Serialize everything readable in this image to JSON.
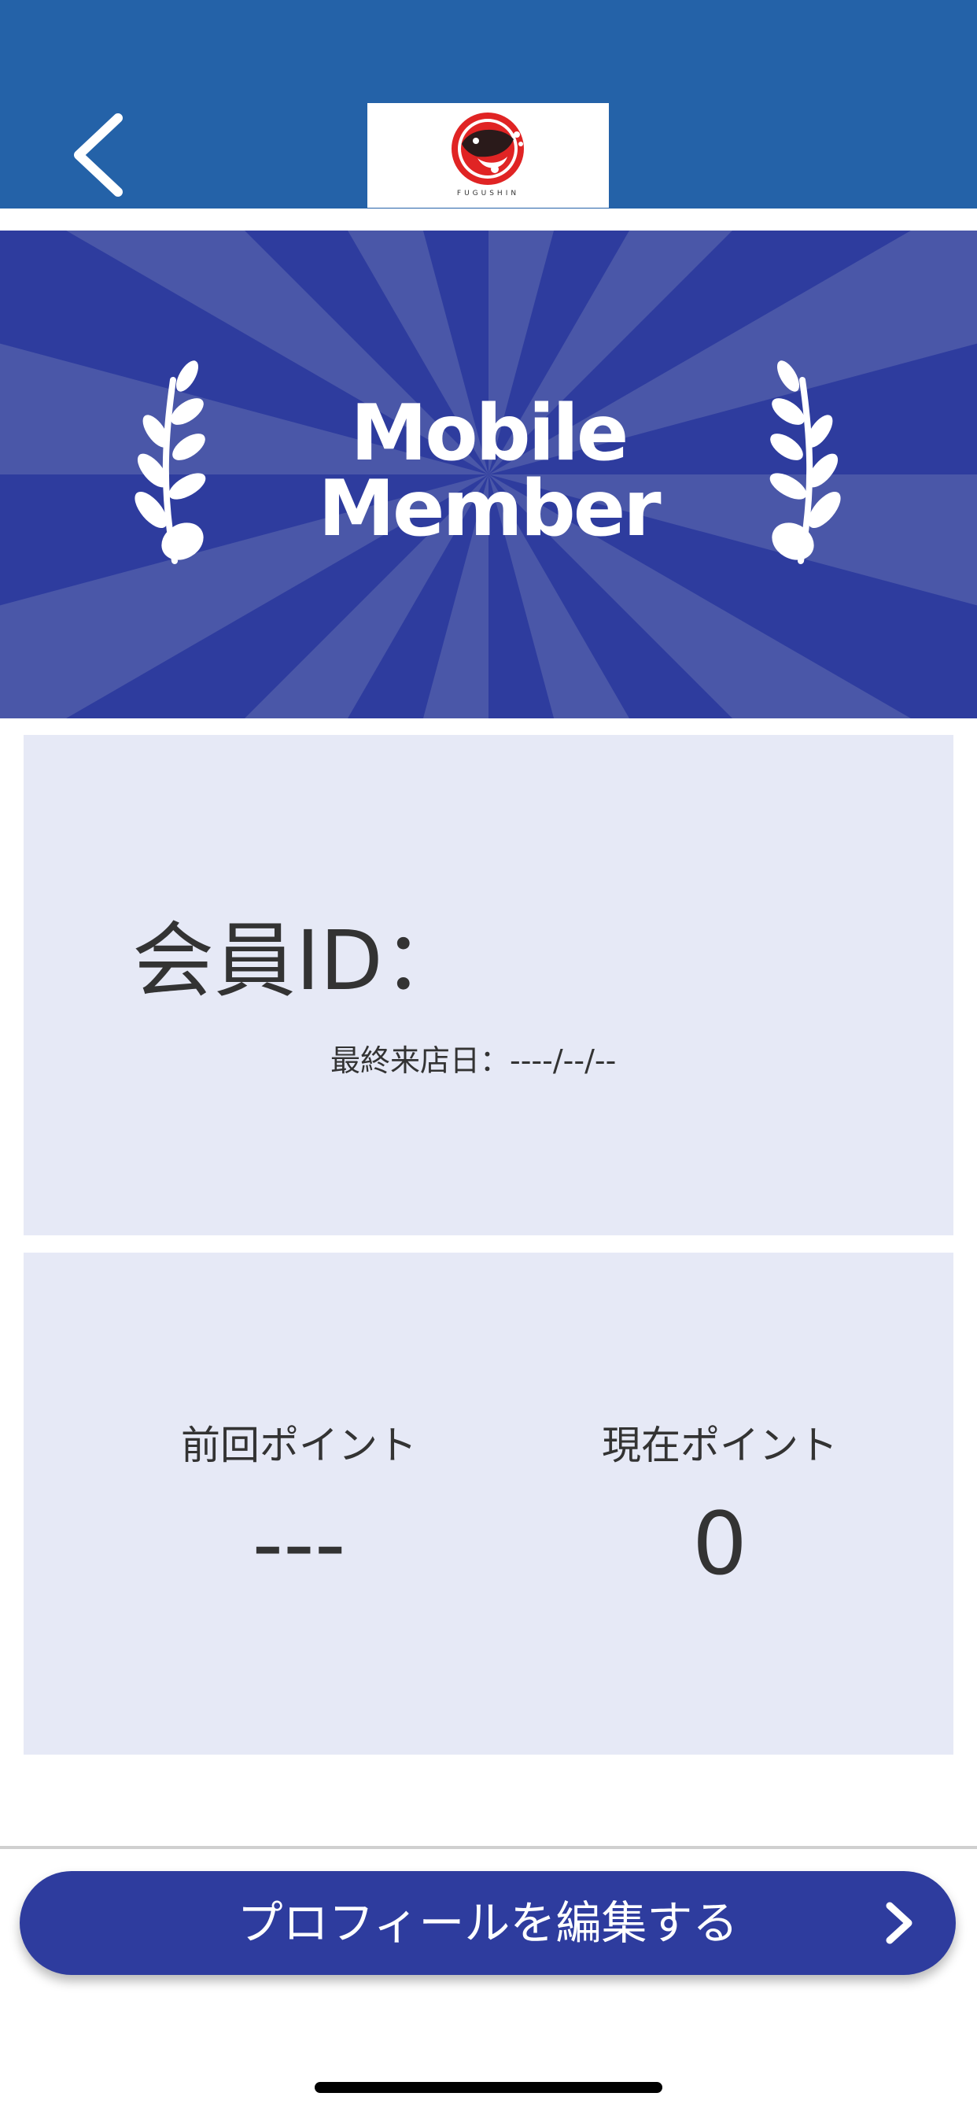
{
  "header": {
    "back_icon": "chevron-left-icon",
    "logo_caption": "FUGUSHIN",
    "background_color": "#2462a8"
  },
  "banner": {
    "title_line1": "Mobile",
    "title_line2": "Member",
    "background_color": "#2e3c9e"
  },
  "member_card": {
    "member_id_label": "会員ID：",
    "last_visit": "最終来店日：----/--/--"
  },
  "points_card": {
    "previous_label": "前回ポイント",
    "previous_value": "---",
    "current_label": "現在ポイント",
    "current_value": "0"
  },
  "footer": {
    "edit_profile_label": "プロフィールを編集する",
    "button_color": "#2e3c9e"
  }
}
